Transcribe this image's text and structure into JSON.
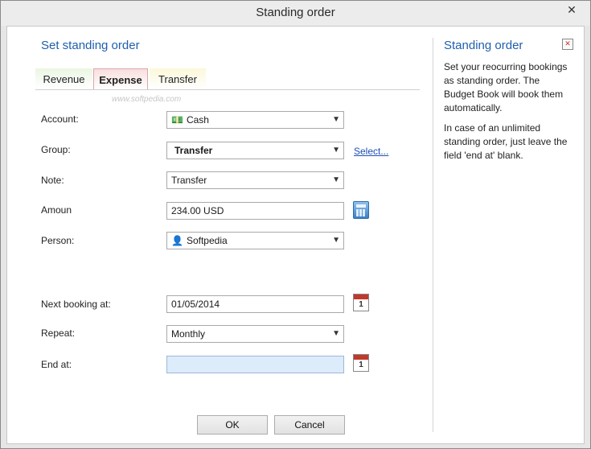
{
  "window": {
    "title": "Standing order",
    "close_glyph": "✕"
  },
  "form": {
    "section_title": "Set standing order",
    "tabs": [
      {
        "label": "Revenue"
      },
      {
        "label": "Expense"
      },
      {
        "label": "Transfer"
      }
    ],
    "active_tab": "Expense",
    "watermark": "www.softpedia.com",
    "fields": {
      "account": {
        "label": "Account:",
        "value": "Cash",
        "icon": "money-icon"
      },
      "group": {
        "label": "Group:",
        "value": "Transfer",
        "link": "Select..."
      },
      "note": {
        "label": "Note:",
        "value": "Transfer"
      },
      "amount": {
        "label": "Amoun",
        "value": "234.00 USD",
        "icon": "calculator-icon"
      },
      "person": {
        "label": "Person:",
        "value": "Softpedia",
        "icon": "person-icon"
      },
      "next_booking": {
        "label": "Next booking at:",
        "value": "01/05/2014",
        "icon": "calendar-icon"
      },
      "repeat": {
        "label": "Repeat:",
        "value": "Monthly"
      },
      "end_at": {
        "label": "End at:",
        "value": "",
        "icon": "calendar-icon"
      }
    },
    "calendar_day": "1",
    "buttons": {
      "ok": "OK",
      "cancel": "Cancel"
    }
  },
  "help": {
    "title": "Standing order",
    "paragraphs": [
      "Set your reocurring bookings as standing order. The Budget Book will book them automatically.",
      "In case of an unlimited standing order, just leave the field 'end at' blank."
    ]
  },
  "colors": {
    "accent": "#1f5fae",
    "link": "#1f4fb5",
    "end_field_bg": "#dcecfb"
  }
}
